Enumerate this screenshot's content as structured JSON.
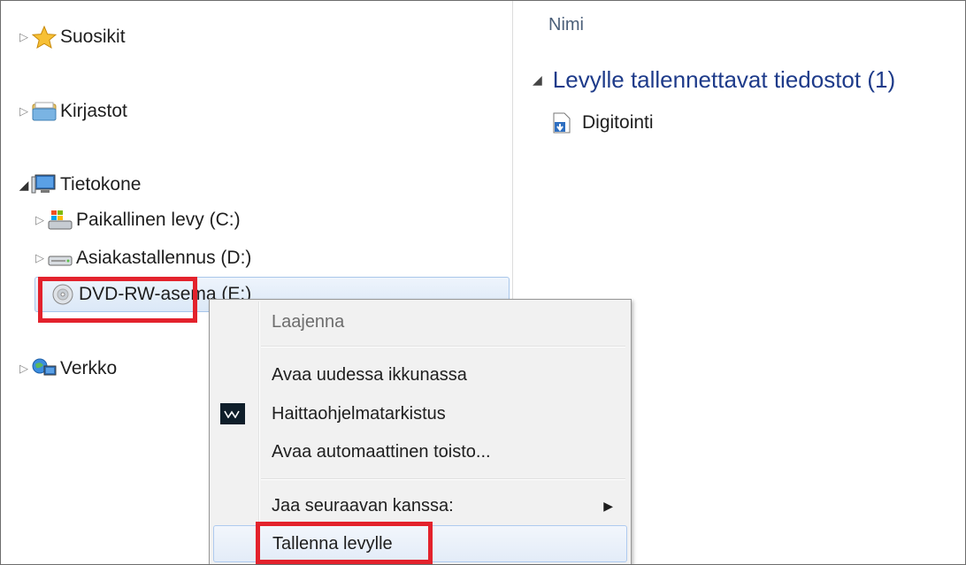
{
  "nav": {
    "favorites": "Suosikit",
    "libraries": "Kirjastot",
    "computer": "Tietokone",
    "drive_c": "Paikallinen levy (C:)",
    "drive_d": "Asiakastallennus (D:)",
    "drive_e": "DVD-RW-asema (E:)",
    "network": "Verkko"
  },
  "content": {
    "column_header": "Nimi",
    "group_title": "Levylle tallennettavat tiedostot (1)",
    "files": [
      "Digitointi"
    ]
  },
  "context_menu": {
    "expand": "Laajenna",
    "open_new_window": "Avaa uudessa ikkunassa",
    "malware_scan": "Haittaohjelmatarkistus",
    "autoplay": "Avaa automaattinen toisto...",
    "share_with": "Jaa seuraavan kanssa:",
    "burn_to_disc": "Tallenna levylle"
  },
  "colors": {
    "highlight_box": "#e3222c",
    "group_title": "#1e3b8a"
  }
}
